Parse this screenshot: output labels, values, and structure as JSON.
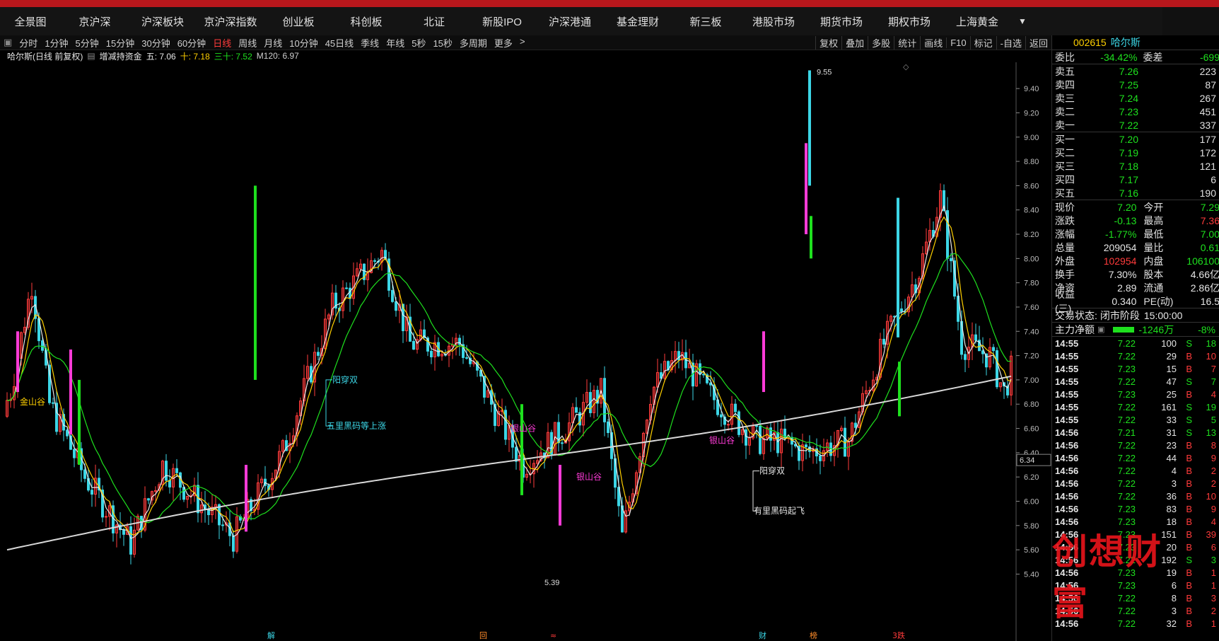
{
  "nav": {
    "items": [
      "全景图",
      "京沪深",
      "沪深板块",
      "京沪深指数",
      "创业板",
      "科创板",
      "北证",
      "新股IPO",
      "沪深港通",
      "基金理财",
      "新三板",
      "港股市场",
      "期货市场",
      "期权市场",
      "上海黄金"
    ]
  },
  "toolbar": {
    "periods": [
      "分时",
      "1分钟",
      "5分钟",
      "15分钟",
      "30分钟",
      "60分钟",
      "日线",
      "周线",
      "月线",
      "10分钟",
      "45日线",
      "季线",
      "年线",
      "5秒",
      "15秒",
      "多周期",
      "更多"
    ],
    "active": "日线",
    "right": [
      "复权",
      "叠加",
      "多股",
      "统计",
      "画线",
      "F10",
      "标记",
      "-自选",
      "返回"
    ]
  },
  "info": {
    "stock": "哈尔斯(日线 前复权)",
    "indicator": "增减持资金",
    "five_label": "五: 7.06",
    "ten_label": "十: 7.18",
    "thirty_label": "三十: 7.52",
    "m120_label": "M120: 6.97"
  },
  "chart": {
    "y_ticks": [
      "9.40",
      "9.20",
      "9.00",
      "8.80",
      "8.60",
      "8.40",
      "8.20",
      "8.00",
      "7.80",
      "7.60",
      "7.40",
      "7.20",
      "7.00",
      "6.80",
      "6.60",
      "6.40",
      "6.20",
      "6.00",
      "5.80",
      "5.60",
      "5.40"
    ],
    "current_price": "6.34",
    "high_label": "9.55",
    "low_label": "5.39",
    "annotations": [
      "金山谷",
      "阳穿双",
      "五里黑码等上涨",
      "银山谷",
      "银山谷",
      "银山谷",
      "阳穿双",
      "有里黑码起飞"
    ],
    "bottom_markers": [
      "解",
      "回",
      "≈",
      "财",
      "榜",
      "3跌"
    ]
  },
  "side": {
    "code": "002615",
    "name": "哈尔斯",
    "weibi": {
      "label": "委比",
      "value": "-34.42%",
      "label2": "委差",
      "value2": "-699"
    },
    "sells": [
      {
        "label": "卖五",
        "price": "7.26",
        "vol": "223"
      },
      {
        "label": "卖四",
        "price": "7.25",
        "vol": "87"
      },
      {
        "label": "卖三",
        "price": "7.24",
        "vol": "267"
      },
      {
        "label": "卖二",
        "price": "7.23",
        "vol": "451"
      },
      {
        "label": "卖一",
        "price": "7.22",
        "vol": "337"
      }
    ],
    "buys": [
      {
        "label": "买一",
        "price": "7.20",
        "vol": "177"
      },
      {
        "label": "买二",
        "price": "7.19",
        "vol": "172"
      },
      {
        "label": "买三",
        "price": "7.18",
        "vol": "121"
      },
      {
        "label": "买四",
        "price": "7.17",
        "vol": "6"
      },
      {
        "label": "买五",
        "price": "7.16",
        "vol": "190"
      }
    ],
    "stats": [
      {
        "k1": "现价",
        "v1": "7.20",
        "k2": "今开",
        "v2": "7.29"
      },
      {
        "k1": "涨跌",
        "v1": "-0.13",
        "k2": "最高",
        "v2": "7.36"
      },
      {
        "k1": "涨幅",
        "v1": "-1.77%",
        "k2": "最低",
        "v2": "7.00"
      },
      {
        "k1": "总量",
        "v1": "209054",
        "k2": "量比",
        "v2": "0.61"
      },
      {
        "k1": "外盘",
        "v1": "102954",
        "k2": "内盘",
        "v2": "106100"
      },
      {
        "k1": "换手",
        "v1": "7.30%",
        "k2": "股本",
        "v2": "4.66亿"
      },
      {
        "k1": "净资",
        "v1": "2.89",
        "k2": "流通",
        "v2": "2.86亿"
      },
      {
        "k1": "收益(三)",
        "v1": "0.340",
        "k2": "PE(动)",
        "v2": "16.5"
      }
    ],
    "trade_state_label": "交易状态:",
    "trade_state": "闭市阶段",
    "trade_time": "15:00:00",
    "main_flow_label": "主力净额",
    "main_flow": "-1246万",
    "main_flow_pct": "-8%",
    "ticks": [
      [
        "14:55",
        "7.22",
        "100",
        "S",
        "18"
      ],
      [
        "14:55",
        "7.22",
        "29",
        "B",
        "10"
      ],
      [
        "14:55",
        "7.23",
        "15",
        "B",
        "7"
      ],
      [
        "14:55",
        "7.22",
        "47",
        "S",
        "7"
      ],
      [
        "14:55",
        "7.23",
        "25",
        "B",
        "4"
      ],
      [
        "14:55",
        "7.22",
        "161",
        "S",
        "19"
      ],
      [
        "14:55",
        "7.22",
        "33",
        "S",
        "5"
      ],
      [
        "14:56",
        "7.21",
        "31",
        "S",
        "13"
      ],
      [
        "14:56",
        "7.22",
        "23",
        "B",
        "8"
      ],
      [
        "14:56",
        "7.22",
        "44",
        "B",
        "9"
      ],
      [
        "14:56",
        "7.22",
        "4",
        "B",
        "2"
      ],
      [
        "14:56",
        "7.22",
        "3",
        "B",
        "2"
      ],
      [
        "14:56",
        "7.22",
        "36",
        "B",
        "10"
      ],
      [
        "14:56",
        "7.23",
        "83",
        "B",
        "9"
      ],
      [
        "14:56",
        "7.23",
        "18",
        "B",
        "4"
      ],
      [
        "14:56",
        "7.23",
        "151",
        "B",
        "39"
      ],
      [
        "14:56",
        "7.23",
        "20",
        "B",
        "6"
      ],
      [
        "14:56",
        "7.22",
        "192",
        "S",
        "3"
      ],
      [
        "14:56",
        "7.23",
        "19",
        "B",
        "1"
      ],
      [
        "14:56",
        "7.23",
        "6",
        "B",
        "1"
      ],
      [
        "14:56",
        "7.22",
        "8",
        "B",
        "3"
      ],
      [
        "14:56",
        "7.22",
        "3",
        "B",
        "2"
      ],
      [
        "14:56",
        "7.22",
        "32",
        "B",
        "1"
      ]
    ],
    "watermark": "创想财富"
  }
}
